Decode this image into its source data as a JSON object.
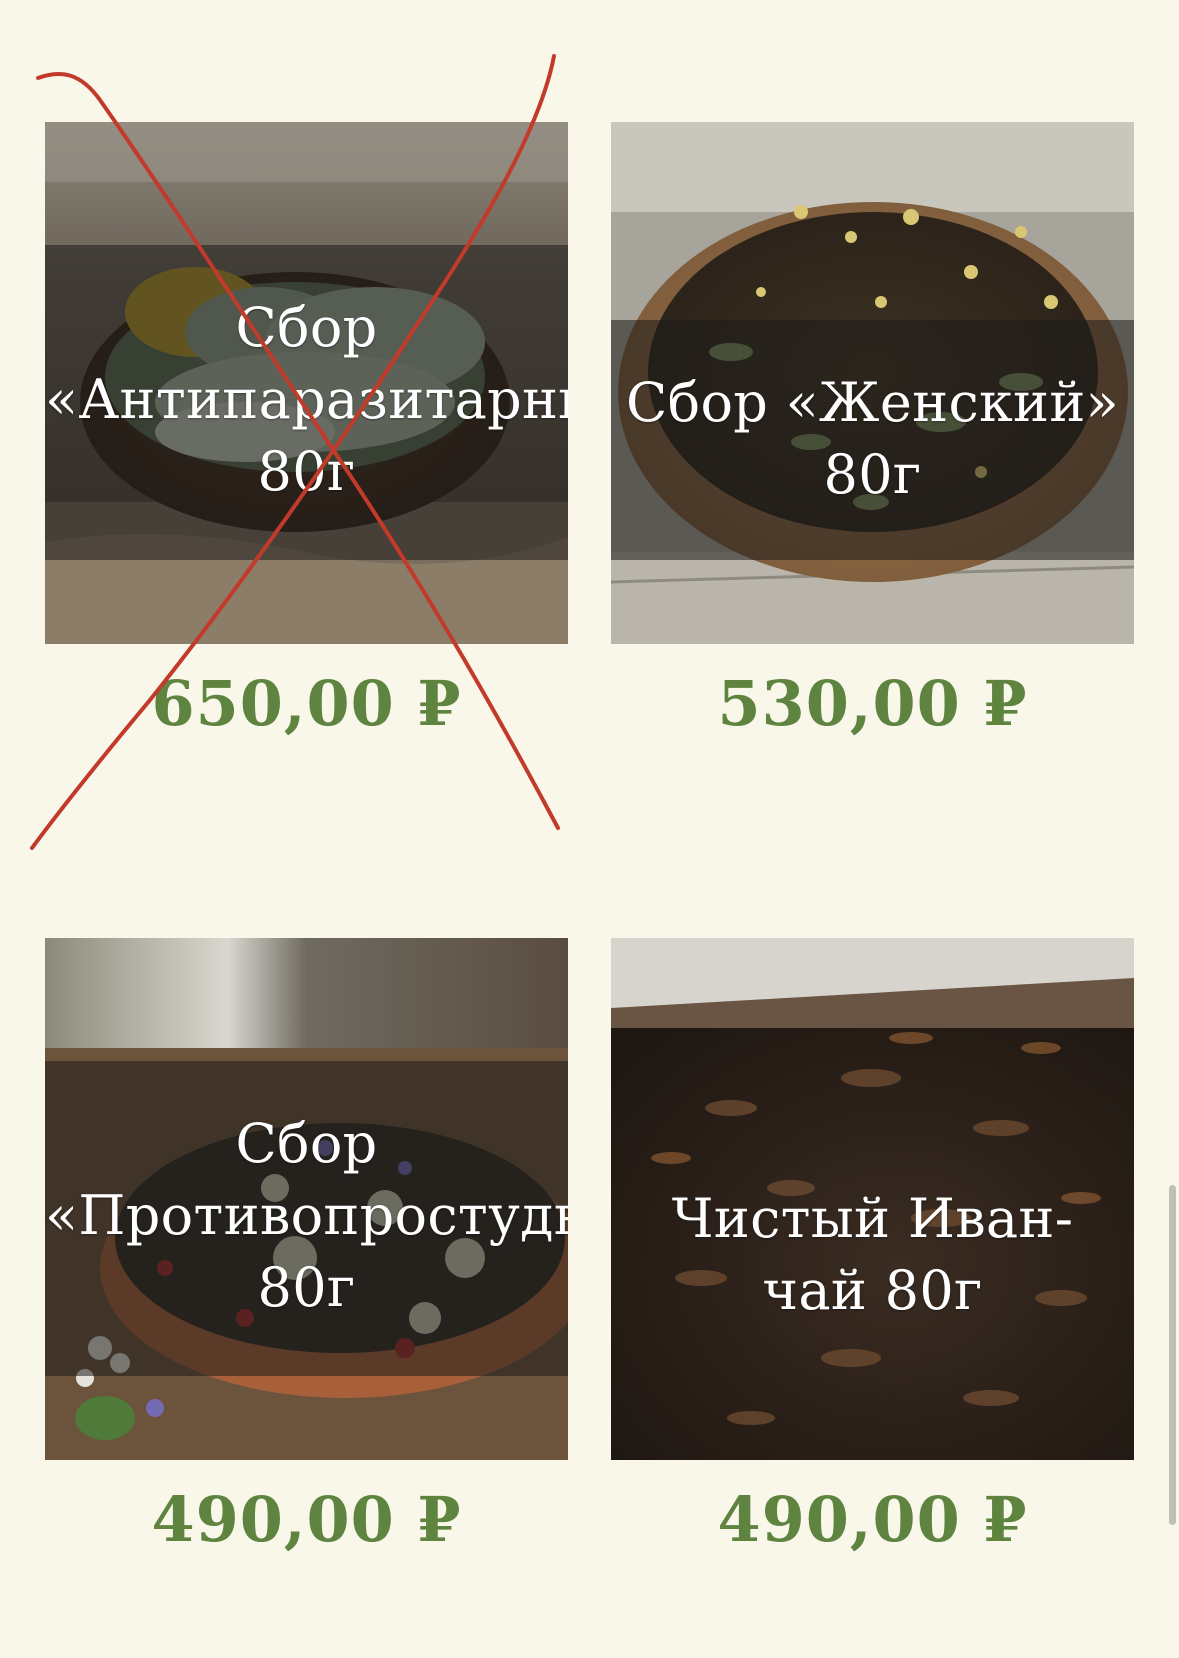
{
  "products": [
    {
      "title_lines": [
        "Сбор",
        "«Антипаразитарный»",
        "80г"
      ],
      "price": "650,00 ₽",
      "crossed_out": true,
      "image": "herbs-wooden-bowl"
    },
    {
      "title_lines": [
        "Сбор «Женский»",
        "80г"
      ],
      "price": "530,00 ₽",
      "crossed_out": false,
      "image": "flower-tea-bowl"
    },
    {
      "title_lines": [
        "Сбор",
        "«Противопростудный»",
        "80г"
      ],
      "price": "490,00 ₽",
      "crossed_out": false,
      "image": "berry-tea-bowl"
    },
    {
      "title_lines": [
        "Чистый Иван-",
        "чай 80г"
      ],
      "price": "490,00 ₽",
      "crossed_out": false,
      "image": "loose-leaf-tea"
    }
  ],
  "colors": {
    "background": "#f8f7ea",
    "price": "#5f8440",
    "cross": "#c23a2a"
  }
}
